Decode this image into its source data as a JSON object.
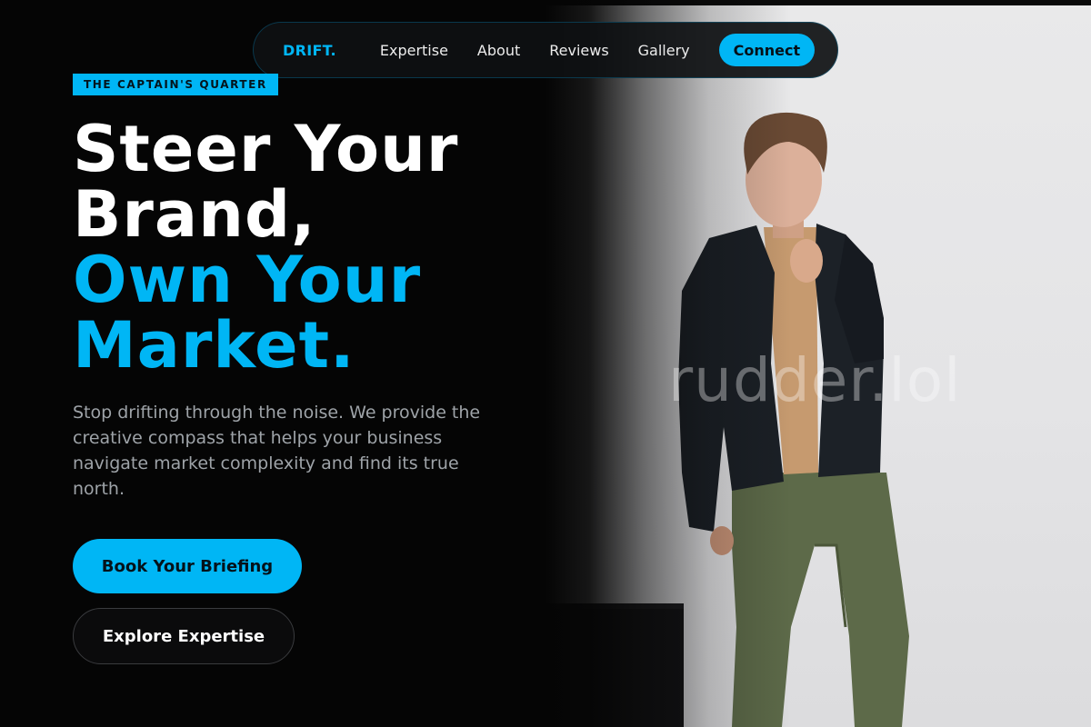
{
  "nav": {
    "brand": "DRIFT.",
    "links": [
      "Expertise",
      "About",
      "Reviews",
      "Gallery"
    ],
    "cta": "Connect"
  },
  "hero": {
    "eyebrow": "THE CAPTAIN'S QUARTER",
    "headline_lines": [
      "Steer Your",
      "Brand,"
    ],
    "headline_accent_lines": [
      "Own Your",
      "Market."
    ],
    "lede": "Stop drifting through the noise. We provide the creative compass that helps your business navigate market complexity and find its true north.",
    "primary_cta": "Book Your Briefing",
    "secondary_cta": "Explore Expertise"
  },
  "photo": {
    "watermark": "rudder.lol"
  },
  "colors": {
    "accent": "#00b6f5",
    "background": "#050505"
  }
}
